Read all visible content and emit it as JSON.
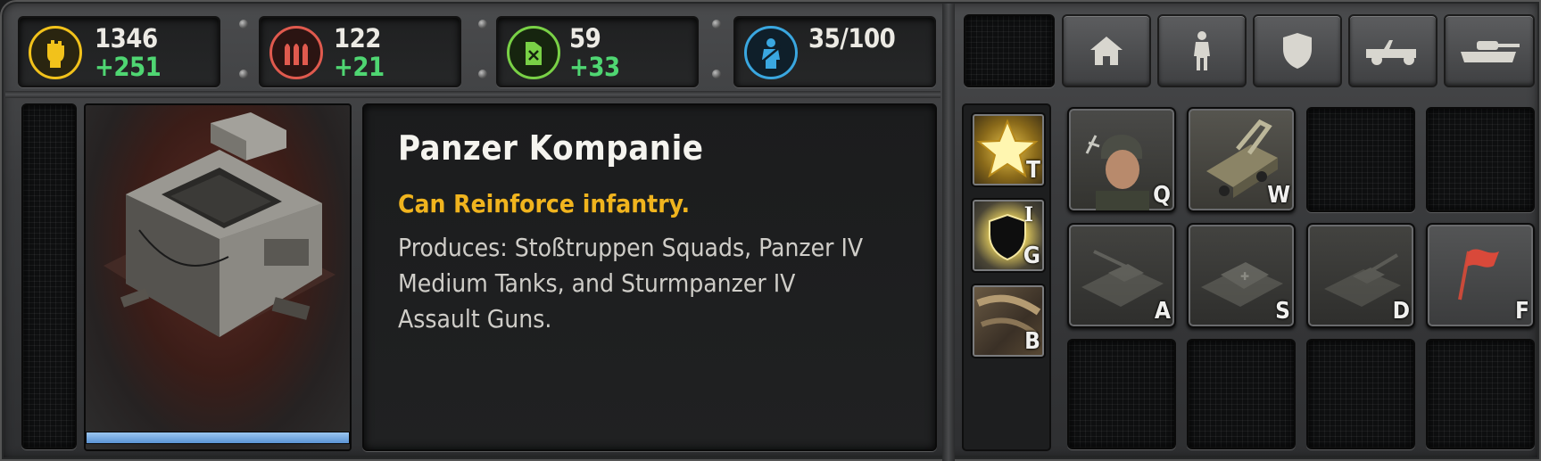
{
  "resources": [
    {
      "id": "manpower",
      "amount": "1346",
      "income": "+251",
      "icon": "fist-icon",
      "color": "#f2c21b"
    },
    {
      "id": "munitions",
      "amount": "122",
      "income": "+21",
      "icon": "ammo-icon",
      "color": "#e05a4e"
    },
    {
      "id": "fuel",
      "amount": "59",
      "income": "+33",
      "icon": "fuel-can-icon",
      "color": "#79d146"
    }
  ],
  "population": {
    "value": "35/100",
    "icon": "soldier-icon",
    "color": "#3aa7e0"
  },
  "categories": [
    "home-icon",
    "infantry-icon",
    "shield-icon",
    "jeep-icon",
    "tank-icon"
  ],
  "building": {
    "name": "Panzer Kompanie",
    "ability": "Can Reinforce infantry.",
    "description": "Produces: Stoßtruppen Squads, Panzer IV Medium Tanks, and Sturmpanzer IV Assault Guns.",
    "progress": 1.0,
    "accent": "#f0b41e"
  },
  "abilities": [
    {
      "hotkey": "T",
      "icon": "star-icon",
      "name": "tier-upgrade"
    },
    {
      "hotkey": "G",
      "icon": "defense-shield-icon",
      "name": "defense",
      "tier": "I"
    },
    {
      "hotkey": "B",
      "icon": "build-icon",
      "name": "build"
    }
  ],
  "commands": [
    {
      "hotkey": "Q",
      "icon": "stosstruppen-icon",
      "name": "stosstruppen-squad",
      "enabled": true
    },
    {
      "hotkey": "W",
      "icon": "repair-vehicle-icon",
      "name": "support-vehicle",
      "enabled": true
    },
    {
      "hotkey": "A",
      "icon": "panzer-iv-icon",
      "name": "panzer-iv",
      "enabled": false
    },
    {
      "hotkey": "S",
      "icon": "sturmpanzer-icon",
      "name": "sturmpanzer-iv",
      "enabled": false
    },
    {
      "hotkey": "D",
      "icon": "tank-destroyer-icon",
      "name": "unit-d",
      "enabled": false
    },
    {
      "hotkey": "F",
      "icon": "rally-flag-icon",
      "name": "rally-point",
      "enabled": true
    }
  ]
}
